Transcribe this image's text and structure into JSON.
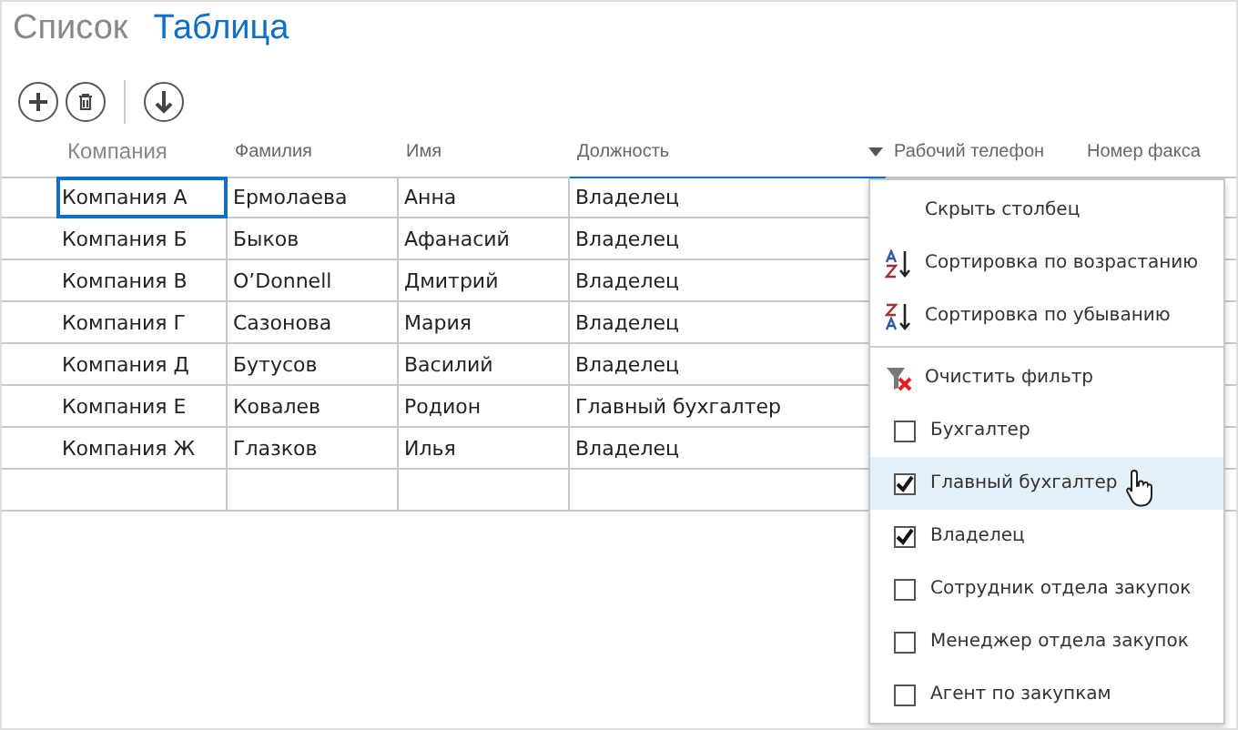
{
  "tabs": [
    {
      "label": "Список",
      "selected": false
    },
    {
      "label": "Таблица",
      "selected": true
    }
  ],
  "toolbar": [
    {
      "kind": "add"
    },
    {
      "kind": "delete"
    },
    {
      "kind": "download"
    }
  ],
  "table": {
    "columns": [
      {
        "label": "Компания",
        "active": true
      },
      {
        "label": "Фамилия",
        "active": false
      },
      {
        "label": "Имя",
        "active": false
      },
      {
        "label": "Должность",
        "active": false,
        "filter_open": true
      },
      {
        "label": "Рабочий телефон",
        "active": false
      },
      {
        "label": "Номер факса",
        "active": false
      }
    ],
    "rows": [
      [
        "Компания А",
        "Ермолаева",
        "Анна",
        "Владелец"
      ],
      [
        "Компания Б",
        "Быков",
        "Афанасий",
        "Владелец"
      ],
      [
        "Компания В",
        "O’Donnell",
        "Дмитрий",
        "Владелец"
      ],
      [
        "Компания Г",
        "Сазонова",
        "Мария",
        "Владелец"
      ],
      [
        "Компания Д",
        "Бутусов",
        "Василий",
        "Владелец"
      ],
      [
        "Компания Е",
        "Ковалев",
        "Родион",
        "Главный бухгалтер"
      ],
      [
        "Компания Ж",
        "Глазков",
        "Илья",
        "Владелец"
      ],
      [
        "",
        "",
        "",
        ""
      ]
    ]
  },
  "menu": {
    "items": [
      {
        "kind": "action",
        "label": "Скрыть столбец"
      },
      {
        "kind": "sort_asc",
        "label": "Сортировка по возрастанию"
      },
      {
        "kind": "sort_desc",
        "label": "Сортировка по убыванию"
      },
      {
        "kind": "clear_filter",
        "label": "Очистить фильтр"
      },
      {
        "kind": "checkbox",
        "label": "Бухгалтер",
        "checked": false,
        "hovered": false
      },
      {
        "kind": "checkbox",
        "label": "Главный бухгалтер",
        "checked": true,
        "hovered": true
      },
      {
        "kind": "checkbox",
        "label": "Владелец",
        "checked": true,
        "hovered": false
      },
      {
        "kind": "checkbox",
        "label": "Сотрудник отдела закупок",
        "checked": false,
        "hovered": false
      },
      {
        "kind": "checkbox",
        "label": "Менеджер отдела закупок",
        "checked": false,
        "hovered": false
      },
      {
        "kind": "checkbox",
        "label": "Агент по закупкам",
        "checked": false,
        "hovered": false
      }
    ]
  }
}
